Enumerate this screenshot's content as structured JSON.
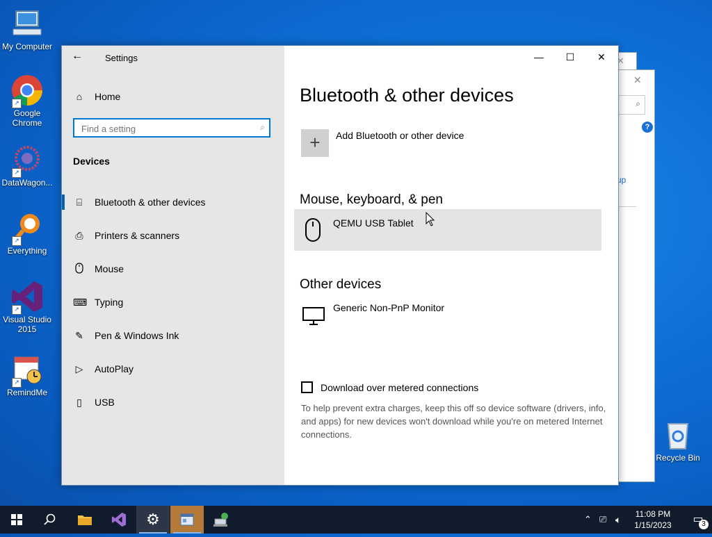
{
  "desktop": {
    "icons": [
      {
        "label": "My Computer"
      },
      {
        "label": "Google Chrome"
      },
      {
        "label": "DataWagon..."
      },
      {
        "label": "Everything"
      },
      {
        "label": "Visual Studio 2015"
      },
      {
        "label": "RemindMe"
      },
      {
        "label": "Recycle Bin"
      }
    ],
    "bg_window_fragment": "up"
  },
  "settings": {
    "window_title": "Settings",
    "nav": {
      "home": "Home",
      "search_placeholder": "Find a setting",
      "section": "Devices",
      "items": [
        {
          "label": "Bluetooth & other devices",
          "icon": "bluetooth-devices-icon",
          "selected": true
        },
        {
          "label": "Printers & scanners",
          "icon": "printer-icon"
        },
        {
          "label": "Mouse",
          "icon": "mouse-icon"
        },
        {
          "label": "Typing",
          "icon": "keyboard-icon"
        },
        {
          "label": "Pen & Windows Ink",
          "icon": "pen-icon"
        },
        {
          "label": "AutoPlay",
          "icon": "autoplay-icon"
        },
        {
          "label": "USB",
          "icon": "usb-icon"
        }
      ]
    },
    "content": {
      "title": "Bluetooth & other devices",
      "add_device": "Add Bluetooth or other device",
      "mouse_section": "Mouse, keyboard, & pen",
      "mouse_device": "QEMU USB Tablet",
      "other_section": "Other devices",
      "other_device": "Generic Non-PnP Monitor",
      "metered_label": "Download over metered connections",
      "metered_checked": false,
      "help_text": "To help prevent extra charges, keep this off so device software (drivers, info, and apps) for new devices won't download while you're on metered Internet connections."
    }
  },
  "taskbar": {
    "time": "11:08 PM",
    "date": "1/15/2023",
    "notifications": "3"
  },
  "colors": {
    "accent": "#0078d7",
    "taskbar": "#101b2b",
    "nav_bg": "#e6e6e6"
  }
}
